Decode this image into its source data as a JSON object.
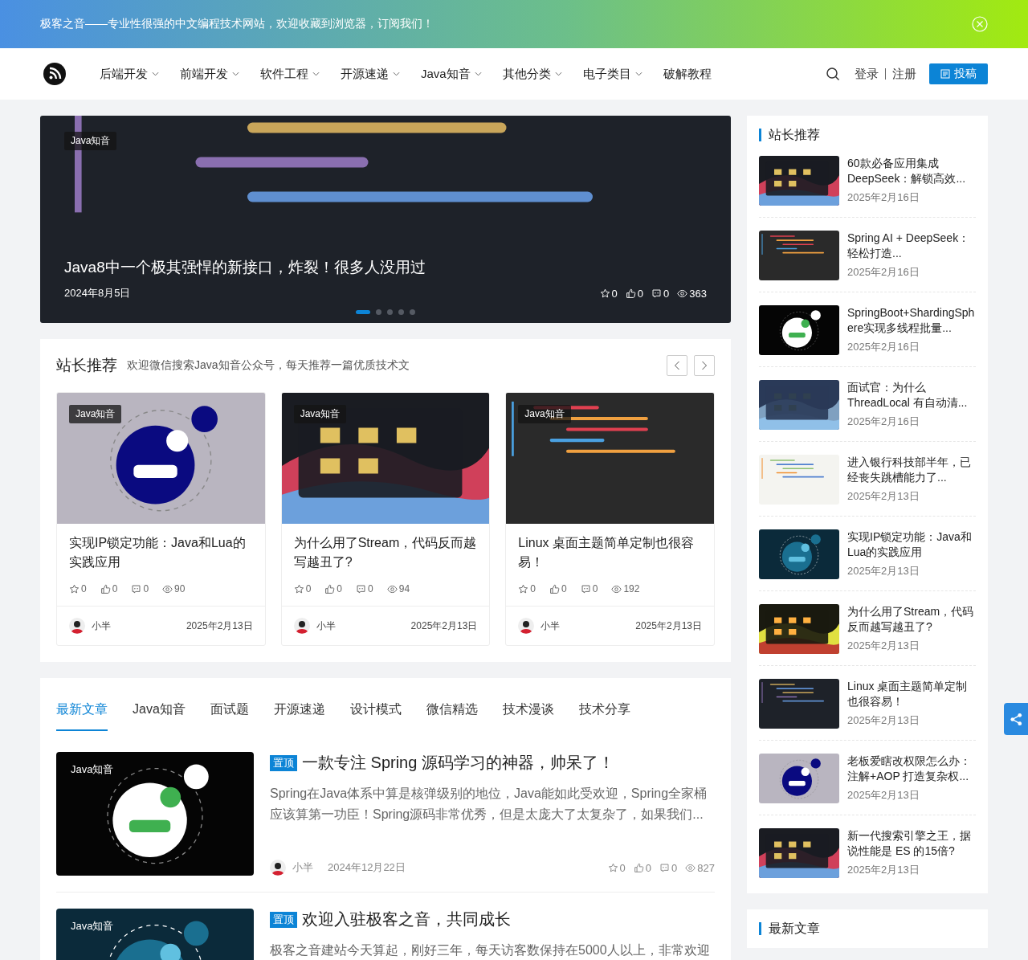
{
  "banner": {
    "text": "极客之音——专业性很强的中文编程技术网站，欢迎收藏到浏览器，订阅我们！"
  },
  "nav": {
    "items": [
      {
        "label": "后端开发",
        "dropdown": true
      },
      {
        "label": "前端开发",
        "dropdown": true
      },
      {
        "label": "软件工程",
        "dropdown": true
      },
      {
        "label": "开源速递",
        "dropdown": true
      },
      {
        "label": "Java知音",
        "dropdown": true
      },
      {
        "label": "其他分类",
        "dropdown": true
      },
      {
        "label": "电子类目",
        "dropdown": true
      },
      {
        "label": "破解教程",
        "dropdown": false
      }
    ],
    "login": "登录",
    "register": "注册",
    "submit": "投稿"
  },
  "hero": {
    "tag": "Java知音",
    "title": "Java8中一个极其强悍的新接口，炸裂！很多人没用过",
    "date": "2024年8月5日",
    "stats": [
      {
        "kind": "star",
        "value": "0"
      },
      {
        "kind": "like",
        "value": "0"
      },
      {
        "kind": "comment",
        "value": "0"
      },
      {
        "kind": "view",
        "value": "363"
      }
    ],
    "dots": [
      {
        "selected": true
      },
      {
        "selected": false
      },
      {
        "selected": false
      },
      {
        "selected": false
      },
      {
        "selected": false
      }
    ]
  },
  "recommend": {
    "title": "站长推荐",
    "subtitle": "欢迎微信搜索Java知音公众号，每天推荐一篇优质技术文",
    "cards": [
      {
        "tag": "Java知音",
        "title": "实现IP锁定功能：Java和Lua的实践应用",
        "stats": [
          {
            "kind": "star",
            "value": "0"
          },
          {
            "kind": "like",
            "value": "0"
          },
          {
            "kind": "comment",
            "value": "0"
          },
          {
            "kind": "view",
            "value": "90"
          }
        ],
        "author": "小半",
        "date": "2025年2月13日"
      },
      {
        "tag": "Java知音",
        "title": "为什么用了Stream，代码反而越写越丑了?",
        "stats": [
          {
            "kind": "star",
            "value": "0"
          },
          {
            "kind": "like",
            "value": "0"
          },
          {
            "kind": "comment",
            "value": "0"
          },
          {
            "kind": "view",
            "value": "94"
          }
        ],
        "author": "小半",
        "date": "2025年2月13日"
      },
      {
        "tag": "Java知音",
        "title": "Linux 桌面主题简单定制也很容易！",
        "stats": [
          {
            "kind": "star",
            "value": "0"
          },
          {
            "kind": "like",
            "value": "0"
          },
          {
            "kind": "comment",
            "value": "0"
          },
          {
            "kind": "view",
            "value": "192"
          }
        ],
        "author": "小半",
        "date": "2025年2月13日"
      }
    ]
  },
  "tabs": [
    {
      "label": "最新文章",
      "selected": true
    },
    {
      "label": "Java知音",
      "selected": false
    },
    {
      "label": "面试题",
      "selected": false
    },
    {
      "label": "开源速递",
      "selected": false
    },
    {
      "label": "设计模式",
      "selected": false
    },
    {
      "label": "微信精选",
      "selected": false
    },
    {
      "label": "技术漫谈",
      "selected": false
    },
    {
      "label": "技术分享",
      "selected": false
    }
  ],
  "articles": [
    {
      "tag": "Java知音",
      "pin": "置顶",
      "title": "一款专注 Spring 源码学习的神器，帅呆了！",
      "excerpt": "Spring在Java体系中算是核弹级别的地位，Java能如此受欢迎，Spring全家桶应该算第一功臣！Spring源码非常优秀，但是太庞大了太复杂了，如果我们...",
      "author": "小半",
      "date": "2024年12月22日",
      "stats": [
        {
          "kind": "star",
          "value": "0"
        },
        {
          "kind": "like",
          "value": "0"
        },
        {
          "kind": "comment",
          "value": "0"
        },
        {
          "kind": "view",
          "value": "827"
        }
      ]
    },
    {
      "tag": "Java知音",
      "pin": "置顶",
      "title": "欢迎入驻极客之音，共同成长",
      "excerpt": "极客之音建站今天算起，刚好三年，每天访客数保持在5000人以上，非常欢迎"
    }
  ],
  "sidebar": {
    "title": "站长推荐",
    "items": [
      {
        "title": "60款必备应用集成DeepSeek：解锁高效...",
        "date": "2025年2月16日"
      },
      {
        "title": "Spring AI + DeepSeek：轻松打造...",
        "date": "2025年2月16日"
      },
      {
        "title": "SpringBoot+ShardingSphere实现多线程批量...",
        "date": "2025年2月16日"
      },
      {
        "title": "面试官：为什么 ThreadLocal 有自动清...",
        "date": "2025年2月16日"
      },
      {
        "title": "进入银行科技部半年，已经丧失跳槽能力了...",
        "date": "2025年2月13日"
      },
      {
        "title": "实现IP锁定功能：Java和Lua的实践应用",
        "date": "2025年2月13日"
      },
      {
        "title": "为什么用了Stream，代码反而越写越丑了?",
        "date": "2025年2月13日"
      },
      {
        "title": "Linux 桌面主题简单定制也很容易！",
        "date": "2025年2月13日"
      },
      {
        "title": "老板爱瞎改权限怎么办：注解+AOP 打造复杂权...",
        "date": "2025年2月13日"
      },
      {
        "title": "新一代搜索引擎之王，据说性能是 ES 的15倍?",
        "date": "2025年2月13日"
      }
    ],
    "next_title": "最新文章"
  }
}
